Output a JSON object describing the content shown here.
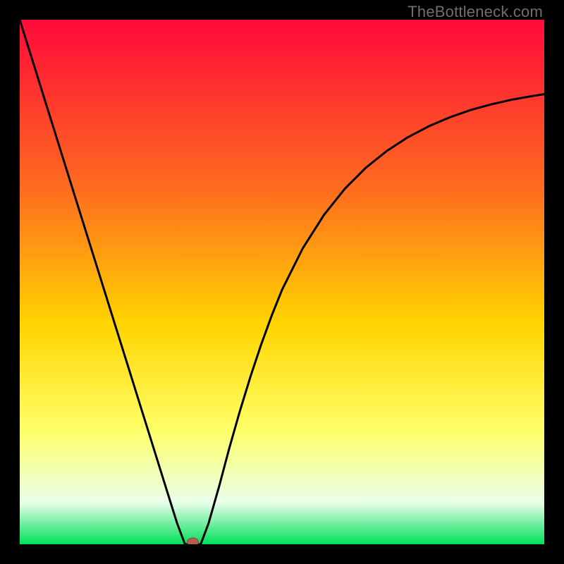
{
  "watermark": "TheBottleneck.com",
  "colors": {
    "top": "#ff0a3a",
    "mid_upper": "#ff6b1f",
    "mid": "#ffd400",
    "mid_lower": "#ffff66",
    "pale": "#eaffea",
    "bottom": "#00e05a",
    "curve": "#000000",
    "marker_fill": "#bb5a52",
    "marker_stroke": "#8a3f39"
  },
  "chart_data": {
    "type": "line",
    "title": "",
    "xlabel": "",
    "ylabel": "",
    "xlim": [
      0,
      100
    ],
    "ylim": [
      0,
      100
    ],
    "grid": false,
    "legend": false,
    "series": [
      {
        "name": "bottleneck-curve-left",
        "x": [
          0,
          2,
          4,
          6,
          8,
          10,
          12,
          14,
          16,
          18,
          20,
          22,
          24,
          26,
          28,
          30,
          31.5
        ],
        "values": [
          100,
          93.6,
          87.2,
          80.8,
          74.4,
          68.0,
          61.6,
          55.2,
          48.8,
          42.4,
          36.0,
          29.6,
          23.2,
          16.8,
          10.4,
          4.0,
          0.0
        ]
      },
      {
        "name": "bottleneck-curve-right",
        "x": [
          34.5,
          36,
          38,
          40,
          42,
          44,
          46,
          48,
          50,
          54,
          58,
          62,
          66,
          70,
          74,
          78,
          82,
          86,
          90,
          94,
          98,
          100
        ],
        "values": [
          0.0,
          4.0,
          11.0,
          18.5,
          25.5,
          32.0,
          38.0,
          43.5,
          48.5,
          56.5,
          62.8,
          67.8,
          71.8,
          75.0,
          77.6,
          79.7,
          81.4,
          82.8,
          83.9,
          84.8,
          85.5,
          85.8
        ]
      }
    ],
    "flat_segment": {
      "x": [
        31.5,
        34.5
      ],
      "y": 0.0
    },
    "marker": {
      "x": 33.0,
      "y": 0.0
    },
    "gradient_stops": [
      {
        "pos": 0.0,
        "color": "#ff0a3a"
      },
      {
        "pos": 0.32,
        "color": "#ff6b1f"
      },
      {
        "pos": 0.58,
        "color": "#ffd400"
      },
      {
        "pos": 0.78,
        "color": "#ffff66"
      },
      {
        "pos": 0.92,
        "color": "#eaffea"
      },
      {
        "pos": 1.0,
        "color": "#00e05a"
      }
    ]
  }
}
